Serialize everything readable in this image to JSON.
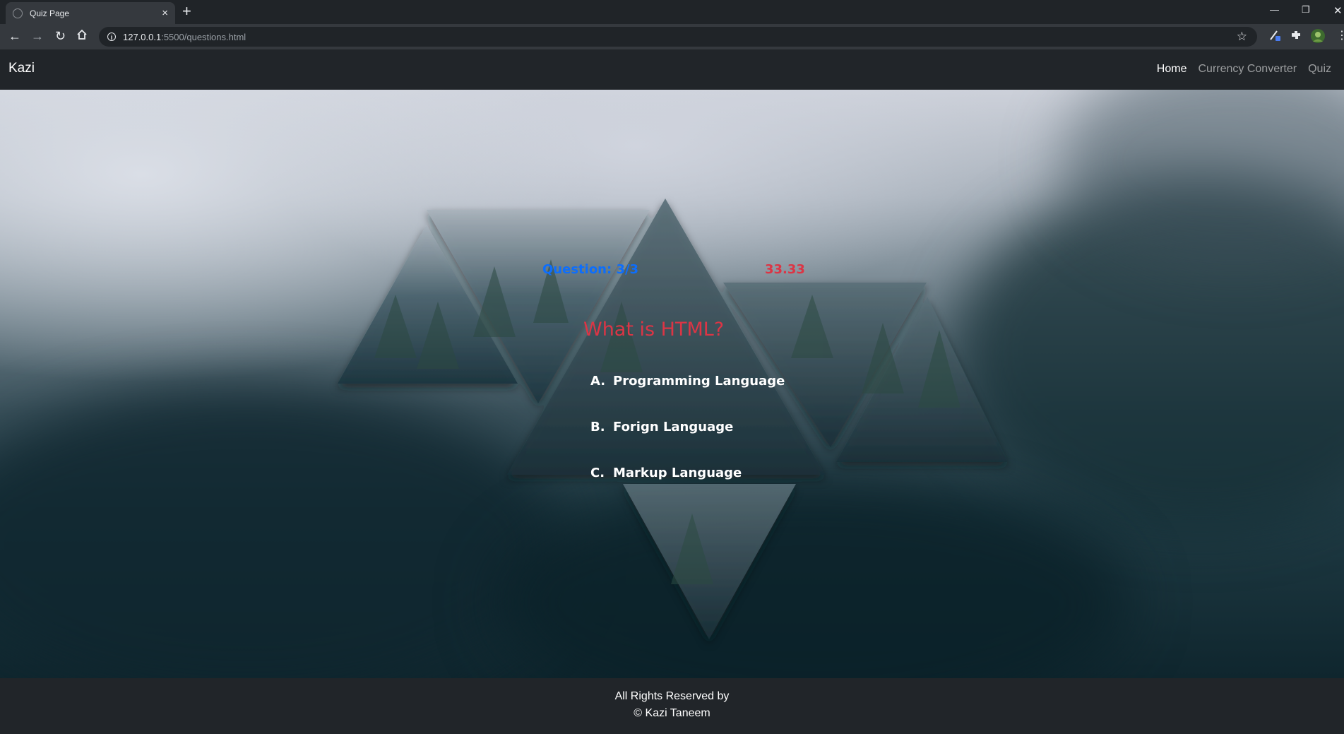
{
  "browser": {
    "tab_title": "Quiz Page",
    "tab_close": "×",
    "new_tab": "+",
    "url_host": "127.0.0.1",
    "url_path": ":5500/questions.html",
    "icons": [
      "back-arrow-icon",
      "forward-arrow-icon",
      "reload-icon",
      "home-icon",
      "info-icon",
      "star-icon",
      "extension-icon",
      "puzzle-icon",
      "profile-avatar-icon"
    ]
  },
  "navbar": {
    "brand": "Kazi",
    "links": [
      "Home",
      "Currency Converter",
      "Quiz"
    ],
    "active_link": "Home"
  },
  "quiz": {
    "counter": "Question: 3/3",
    "score": "33.33",
    "question": "What is HTML?",
    "options": [
      {
        "letter": "A.",
        "text": "Programming Language"
      },
      {
        "letter": "B.",
        "text": "Forign Language"
      },
      {
        "letter": "C.",
        "text": "Markup Language"
      }
    ]
  },
  "footer": {
    "line1": "All Rights Reserved by",
    "line2": "© Kazi Taneem"
  },
  "colors": {
    "counter": "#0d6efd",
    "score": "#dc3545",
    "question": "#dc3545",
    "navbar_bg": "#212529"
  }
}
